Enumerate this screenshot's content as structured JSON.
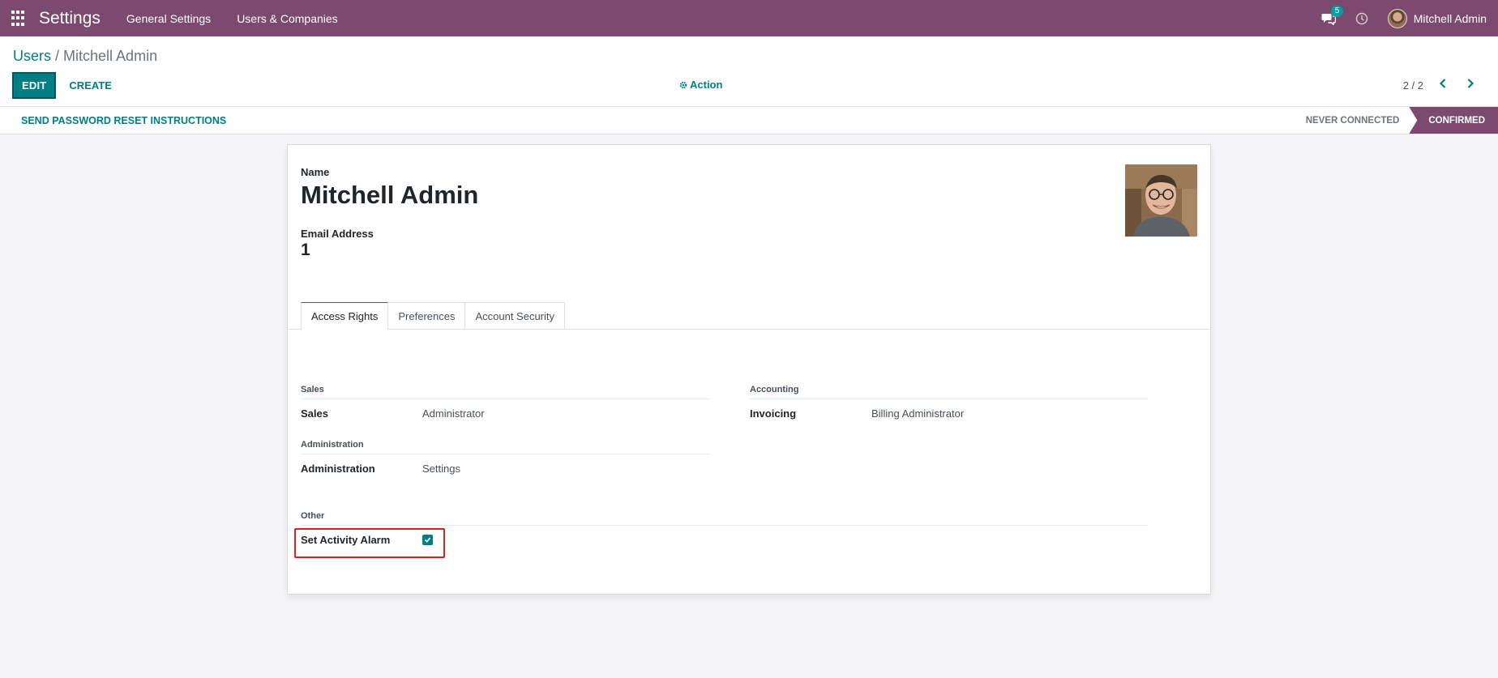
{
  "navbar": {
    "app_title": "Settings",
    "menu_items": [
      "General Settings",
      "Users & Companies"
    ],
    "chat_badge": "5",
    "user_name": "Mitchell Admin",
    "bg_color": "#7c4a6e"
  },
  "breadcrumb": {
    "parent": "Users",
    "separator": " / ",
    "current": "Mitchell Admin"
  },
  "control": {
    "edit_label": "EDIT",
    "create_label": "CREATE",
    "action_label": "Action",
    "pager": "2 / 2"
  },
  "statusbar": {
    "action_label": "SEND PASSWORD RESET INSTRUCTIONS",
    "stages": [
      "NEVER CONNECTED",
      "CONFIRMED"
    ],
    "current_stage": "CONFIRMED"
  },
  "form": {
    "name_label": "Name",
    "name_value": "Mitchell Admin",
    "email_label": "Email Address",
    "email_value": "1",
    "tabs": [
      "Access Rights",
      "Preferences",
      "Account Security"
    ],
    "active_tab": "Access Rights",
    "groups": {
      "sales": {
        "title": "Sales",
        "field_label": "Sales",
        "field_value": "Administrator"
      },
      "accounting": {
        "title": "Accounting",
        "field_label": "Invoicing",
        "field_value": "Billing Administrator"
      },
      "administration": {
        "title": "Administration",
        "field_label": "Administration",
        "field_value": "Settings"
      },
      "other": {
        "title": "Other",
        "field_label": "Set Activity Alarm",
        "checked": true
      }
    }
  },
  "colors": {
    "accent": "#017e84",
    "brand": "#7c4a6e",
    "highlight": "#e0201c"
  }
}
